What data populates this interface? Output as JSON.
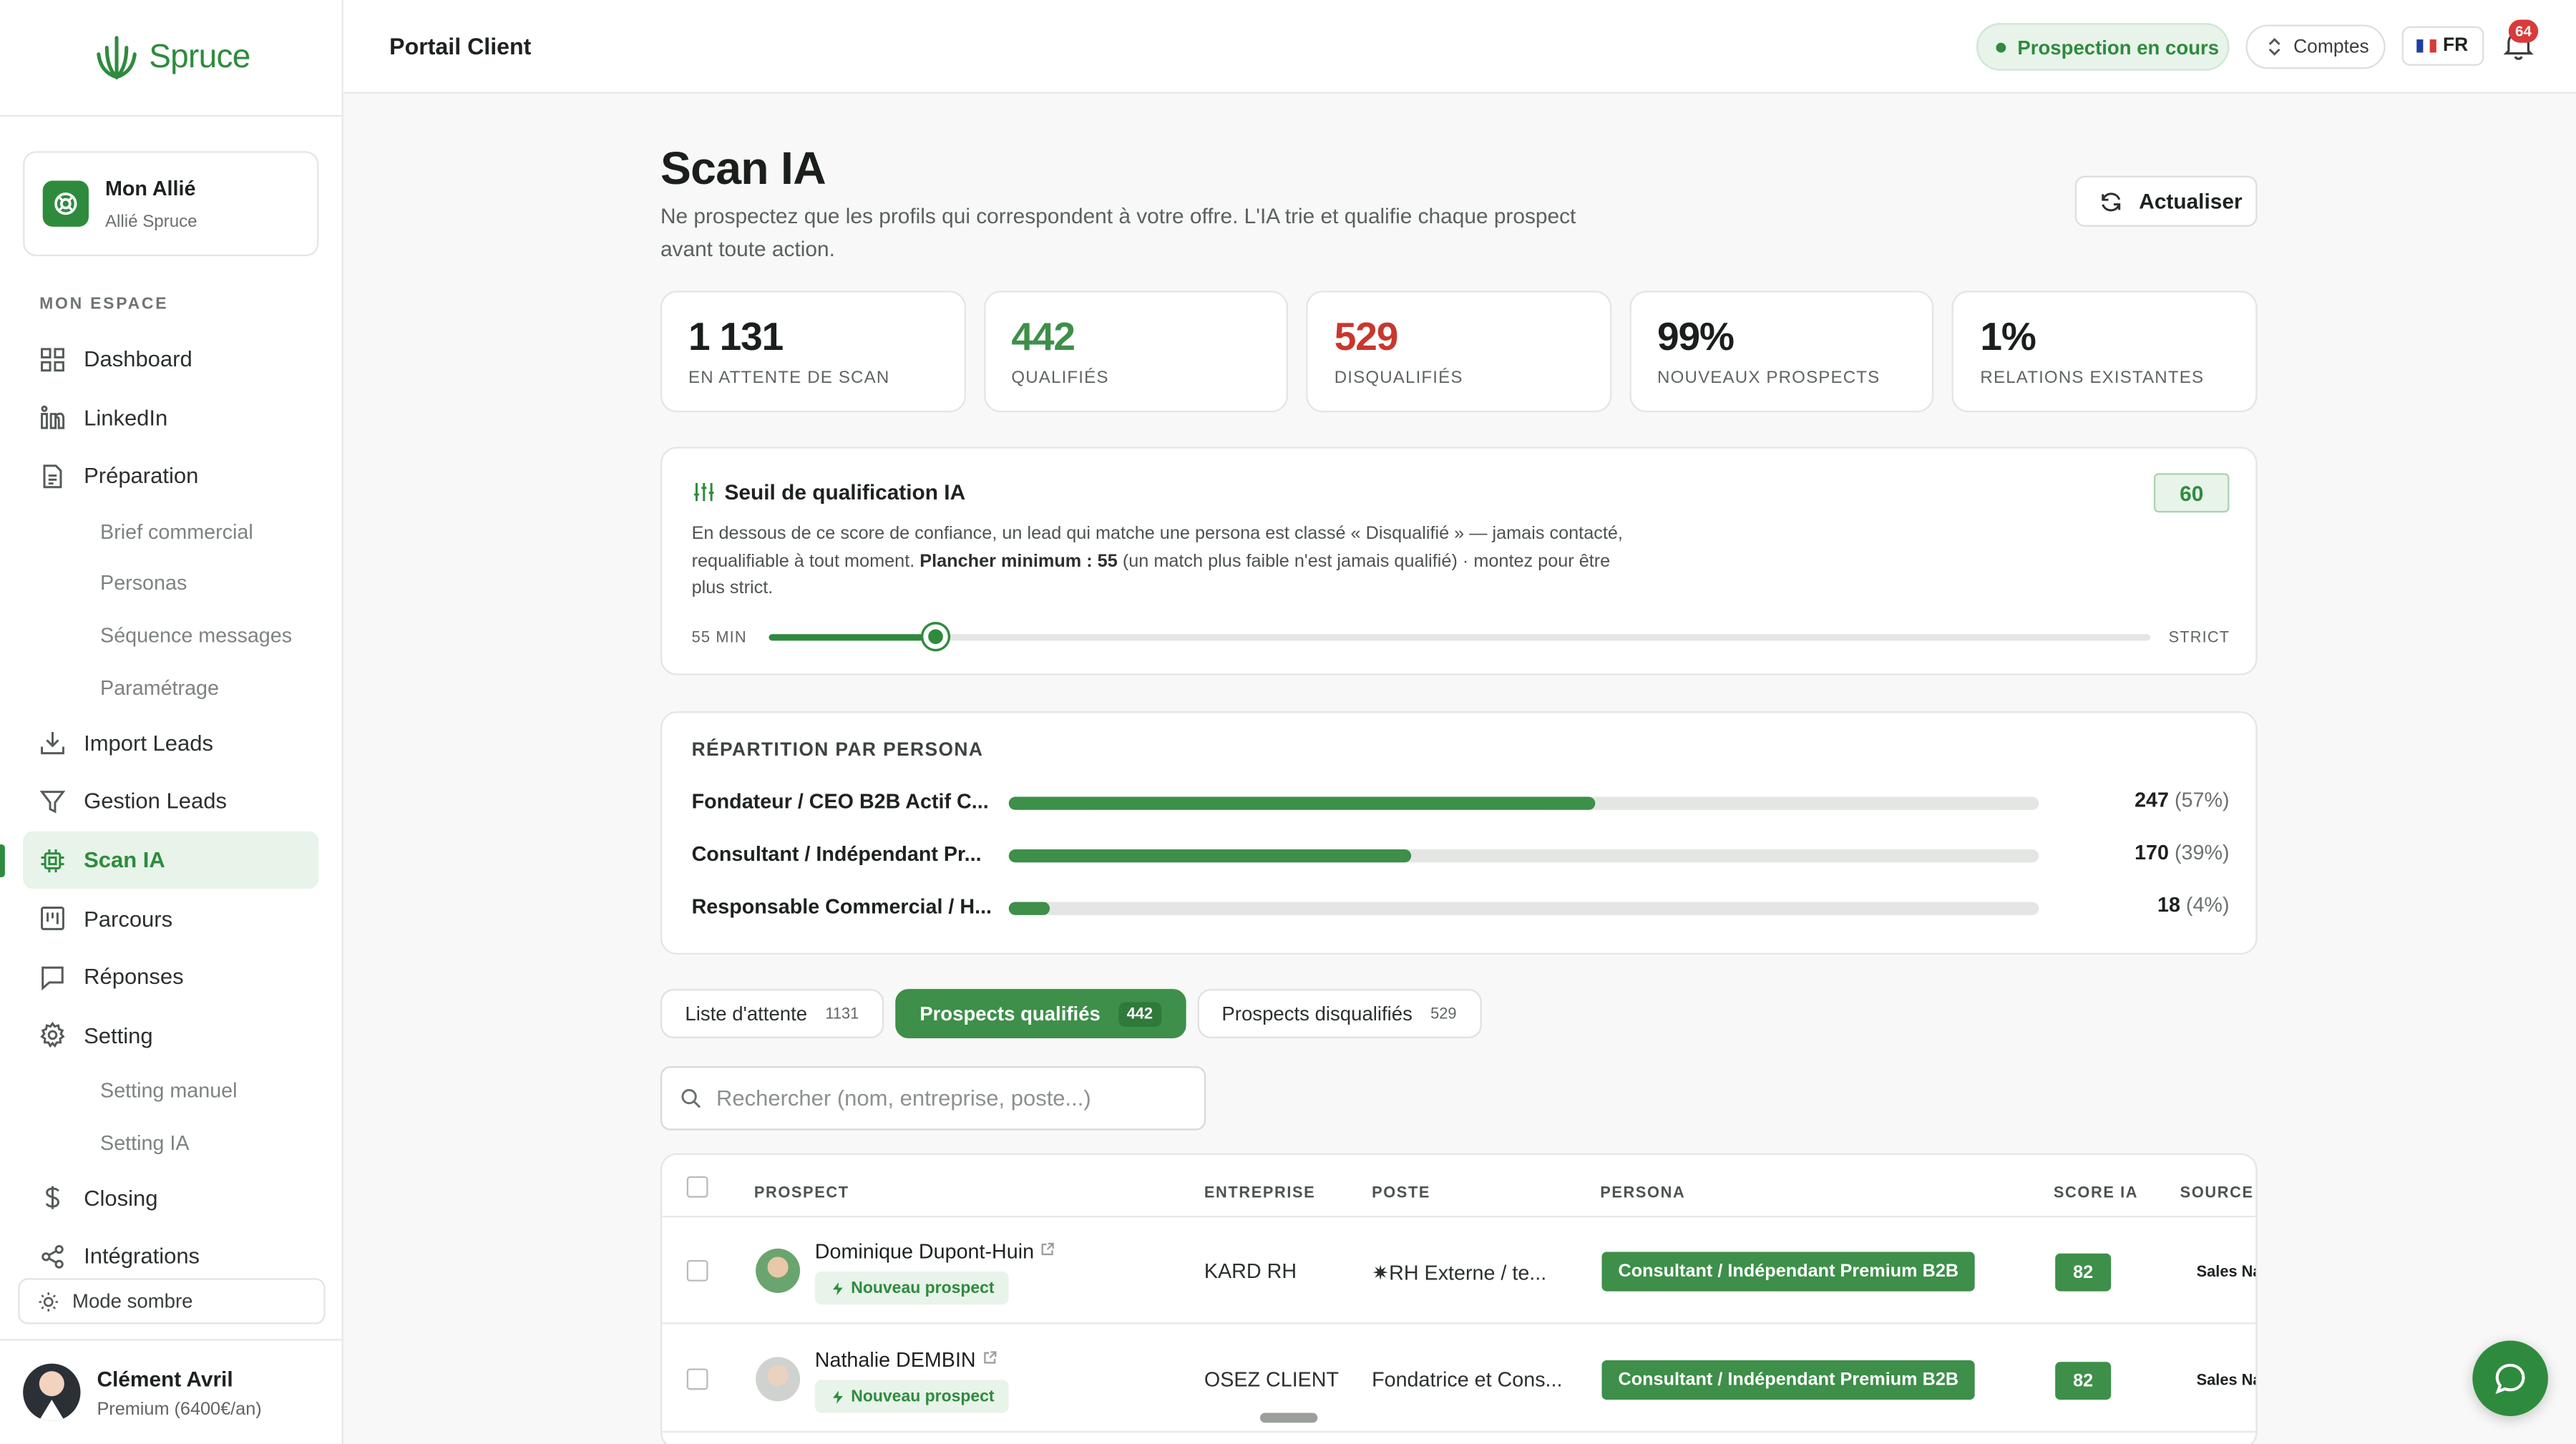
{
  "brand": {
    "name": "Spruce",
    "color": "#2e8b3d"
  },
  "ally_card": {
    "title": "Mon Allié",
    "subtitle": "Allié Spruce"
  },
  "sidebar": {
    "section_label": "MON ESPACE",
    "items": [
      {
        "label": "Dashboard",
        "icon": "grid-icon"
      },
      {
        "label": "LinkedIn",
        "icon": "linkedin-icon"
      },
      {
        "label": "Préparation",
        "icon": "document-icon"
      },
      {
        "label": "Brief commercial",
        "sub": true
      },
      {
        "label": "Personas",
        "sub": true
      },
      {
        "label": "Séquence messages",
        "sub": true
      },
      {
        "label": "Paramétrage",
        "sub": true
      },
      {
        "label": "Import Leads",
        "icon": "download-icon"
      },
      {
        "label": "Gestion Leads",
        "icon": "filter-icon"
      },
      {
        "label": "Scan IA",
        "icon": "chip-icon",
        "active": true
      },
      {
        "label": "Parcours",
        "icon": "kanban-icon"
      },
      {
        "label": "Réponses",
        "icon": "chat-icon"
      },
      {
        "label": "Setting",
        "icon": "gear-icon"
      },
      {
        "label": "Setting manuel",
        "sub": true
      },
      {
        "label": "Setting IA",
        "sub": true
      },
      {
        "label": "Closing",
        "icon": "dollar-icon"
      },
      {
        "label": "Intégrations",
        "icon": "share-icon"
      }
    ],
    "dark_mode_label": "Mode sombre",
    "user": {
      "name": "Clément Avril",
      "plan": "Premium (6400€/an)"
    }
  },
  "topbar": {
    "title": "Portail Client",
    "status": "Prospection en cours",
    "accounts": "Comptes",
    "lang": "FR",
    "notifications": "64"
  },
  "page": {
    "title": "Scan IA",
    "description": "Ne prospectez que les profils qui correspondent à votre offre. L'IA trie et qualifie chaque prospect avant toute action.",
    "refresh_label": "Actualiser"
  },
  "stats": [
    {
      "value": "1 131",
      "label": "EN ATTENTE DE SCAN",
      "color": "#1a1f1c"
    },
    {
      "value": "442",
      "label": "QUALIFIÉS",
      "color": "#3d8f49"
    },
    {
      "value": "529",
      "label": "DISQUALIFIÉS",
      "color": "#c8372d"
    },
    {
      "value": "99%",
      "label": "NOUVEAUX PROSPECTS",
      "color": "#1a1f1c"
    },
    {
      "value": "1%",
      "label": "RELATIONS EXISTANTES",
      "color": "#1a1f1c"
    }
  ],
  "threshold": {
    "title": "Seuil de qualification IA",
    "value": "60",
    "desc_part1": "En dessous de ce score de confiance, un lead qui matche une persona est classé « Disqualifié » — jamais contacté, requalifiable à tout moment.",
    "desc_bold": "Plancher minimum : 55",
    "desc_part2": "(un match plus faible n'est jamais qualifié) · montez pour être plus strict.",
    "min_label": "55 MIN",
    "max_label": "STRICT",
    "slider_fraction": 0.12
  },
  "personas": {
    "title": "RÉPARTITION PAR PERSONA",
    "rows": [
      {
        "name": "Fondateur / CEO B2B Actif C...",
        "count": "247",
        "pct": "(57%)",
        "fraction": 0.57
      },
      {
        "name": "Consultant / Indépendant Pr...",
        "count": "170",
        "pct": "(39%)",
        "fraction": 0.39
      },
      {
        "name": "Responsable Commercial / H...",
        "count": "18",
        "pct": "(4%)",
        "fraction": 0.04
      }
    ]
  },
  "tabs": [
    {
      "label": "Liste d'attente",
      "count": "1131",
      "active": false
    },
    {
      "label": "Prospects qualifiés",
      "count": "442",
      "active": true
    },
    {
      "label": "Prospects disqualifiés",
      "count": "529",
      "active": false
    }
  ],
  "search": {
    "placeholder": "Rechercher (nom, entreprise, poste...)"
  },
  "table": {
    "headers": [
      "PROSPECT",
      "ENTREPRISE",
      "POSTE",
      "PERSONA",
      "SCORE IA",
      "SOURCE I"
    ],
    "rows": [
      {
        "name": "Dominique Dupont-Huin",
        "tag": "Nouveau prospect",
        "company": "KARD RH",
        "role": "✷RH Externe / te...",
        "persona": "Consultant / Indépendant Premium B2B",
        "score": "82",
        "source": "Sales Na"
      },
      {
        "name": "Nathalie DEMBIN",
        "tag": "Nouveau prospect",
        "company": "OSEZ CLIENT",
        "role": "Fondatrice et Cons...",
        "persona": "Consultant / Indépendant Premium B2B",
        "score": "82",
        "source": "Sales Na"
      }
    ]
  }
}
